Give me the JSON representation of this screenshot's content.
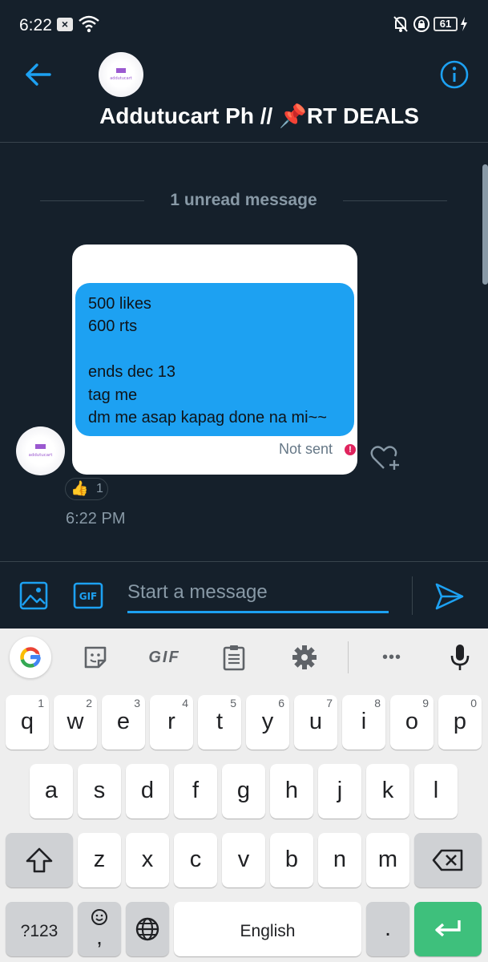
{
  "status_bar": {
    "time": "6:22",
    "notification_x": "×",
    "battery": "61"
  },
  "header": {
    "title": "Addutucart Ph // 📌RT DEALS",
    "back_icon": "arrow-left-icon",
    "info_icon": "info-icon",
    "avatar_text": "Addutucart Ph"
  },
  "divider": {
    "label": "1 unread message"
  },
  "message": {
    "lines": [
      "500 likes",
      "600 rts",
      "",
      "ends dec 13",
      "tag me",
      "dm me asap kapag done na mi~~"
    ],
    "status": "Not sent",
    "status_icon": "!",
    "reaction_emoji": "👍",
    "reaction_count": "1",
    "time": "6:22 PM"
  },
  "composer": {
    "placeholder": "Start a message",
    "gif_label": "GIF"
  },
  "keyboard": {
    "toolbar": {
      "gif_label": "GIF",
      "more_label": "•••"
    },
    "row1": [
      {
        "k": "q",
        "s": "1"
      },
      {
        "k": "w",
        "s": "2"
      },
      {
        "k": "e",
        "s": "3"
      },
      {
        "k": "r",
        "s": "4"
      },
      {
        "k": "t",
        "s": "5"
      },
      {
        "k": "y",
        "s": "6"
      },
      {
        "k": "u",
        "s": "7"
      },
      {
        "k": "i",
        "s": "8"
      },
      {
        "k": "o",
        "s": "9"
      },
      {
        "k": "p",
        "s": "0"
      }
    ],
    "row2": [
      "a",
      "s",
      "d",
      "f",
      "g",
      "h",
      "j",
      "k",
      "l"
    ],
    "row3": [
      "z",
      "x",
      "c",
      "v",
      "b",
      "n",
      "m"
    ],
    "symbols_label": "?123",
    "comma_label": ",",
    "space_label": "English",
    "period_label": ".",
    "accent_color": "#3ec07c"
  },
  "colors": {
    "accent": "#1da1f2",
    "background": "#15202b",
    "error": "#e0245e"
  }
}
